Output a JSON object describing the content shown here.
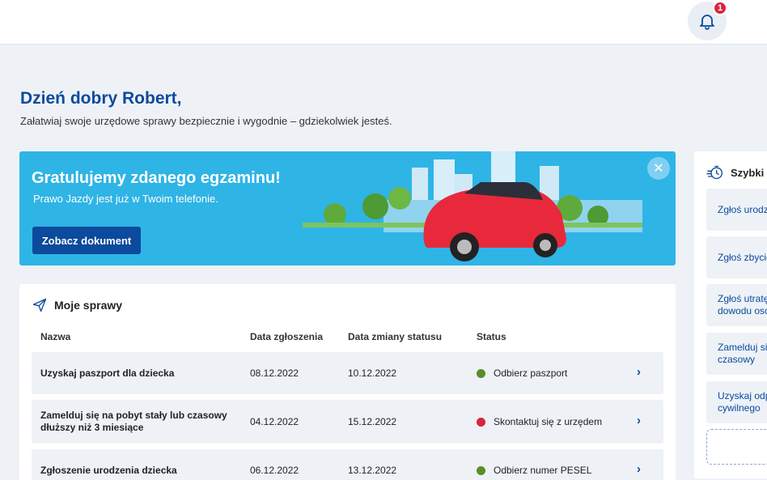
{
  "header": {
    "notifications_count": "1",
    "bell_icon": "bell-icon"
  },
  "greeting": "Dzień dobry Robert,",
  "subtitle": "Załatwiaj swoje urzędowe sprawy bezpiecznie i wygodnie – gdziekolwiek jesteś.",
  "banner": {
    "title": "Gratulujemy zdanego egzaminu!",
    "text": "Prawo Jazdy jest już w Twoim telefonie.",
    "button": "Zobacz dokument",
    "close": "✕",
    "background_color": "#2fb4e6"
  },
  "cases": {
    "title": "Moje sprawy",
    "columns": [
      "Nazwa",
      "Data zgłoszenia",
      "Data zmiany statusu",
      "Status"
    ],
    "rows": [
      {
        "name": "Uzyskaj paszport dla dziecka",
        "submitted": "08.12.2022",
        "changed": "10.12.2022",
        "status": "Odbierz paszport",
        "status_color": "#5b8c2a"
      },
      {
        "name": "Zamelduj się na pobyt stały lub czasowy dłuższy niż 3 miesiące",
        "submitted": "04.12.2022",
        "changed": "15.12.2022",
        "status": "Skontaktuj się z urzędem",
        "status_color": "#d7263d"
      },
      {
        "name": "Zgłoszenie urodzenia dziecka",
        "submitted": "06.12.2022",
        "changed": "13.12.2022",
        "status": "Odbierz numer PESEL",
        "status_color": "#5b8c2a"
      }
    ]
  },
  "quick": {
    "title": "Szybki d",
    "items": [
      "Zgłoś urodz",
      "Zgłoś zbycie",
      "Zgłoś utratę\ndowodu oso",
      "Zamelduj si\nczasowy",
      "Uzyskaj odp\ncywilnego"
    ]
  },
  "colors": {
    "brand": "#0b4a9c",
    "background": "#eef2f7"
  }
}
